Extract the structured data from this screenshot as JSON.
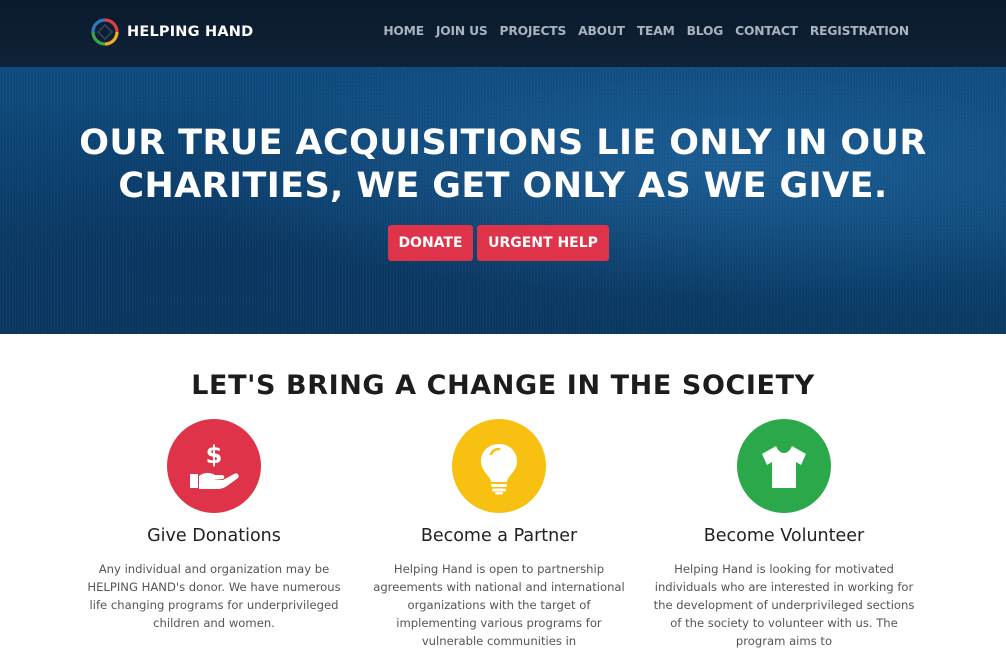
{
  "brand": {
    "name": "HELPING HAND",
    "logo_icon": "circular-arrows-logo-icon"
  },
  "nav": {
    "items": [
      "HOME",
      "JOIN US",
      "PROJECTS",
      "ABOUT",
      "TEAM",
      "BLOG",
      "CONTACT",
      "REGISTRATION"
    ]
  },
  "hero": {
    "title": "OUR TRUE ACQUISITIONS LIE ONLY IN OUR CHARITIES, WE GET ONLY AS WE GIVE.",
    "buttons": {
      "donate": "DONATE",
      "urgent": "URGENT HELP"
    }
  },
  "section": {
    "title": "LET'S BRING A CHANGE IN THE SOCIETY",
    "features": [
      {
        "title": "Give Donations",
        "description": "Any individual and organization may be HELPING HAND's donor. We have numerous life changing programs for underprivileged children and women.",
        "icon": "dollar-hand-icon",
        "color": "#de3348"
      },
      {
        "title": "Become a Partner",
        "description": "Helping Hand is open to partnership agreements with national and international organizations with the target of implementing various programs for vulnerable communities in",
        "icon": "lightbulb-icon",
        "color": "#f8c010"
      },
      {
        "title": "Become Volunteer",
        "description": "Helping Hand is looking for motivated individuals who are interested in working for the development of underprivileged sections of the society to volunteer with us. The program aims to",
        "icon": "tshirt-icon",
        "color": "#2aa84a"
      }
    ]
  },
  "colors": {
    "accent": "#de3348",
    "navbar_bg": "#0d1e33",
    "hero_bg": "#0c4676",
    "nav_link": "#a8b3bf"
  }
}
